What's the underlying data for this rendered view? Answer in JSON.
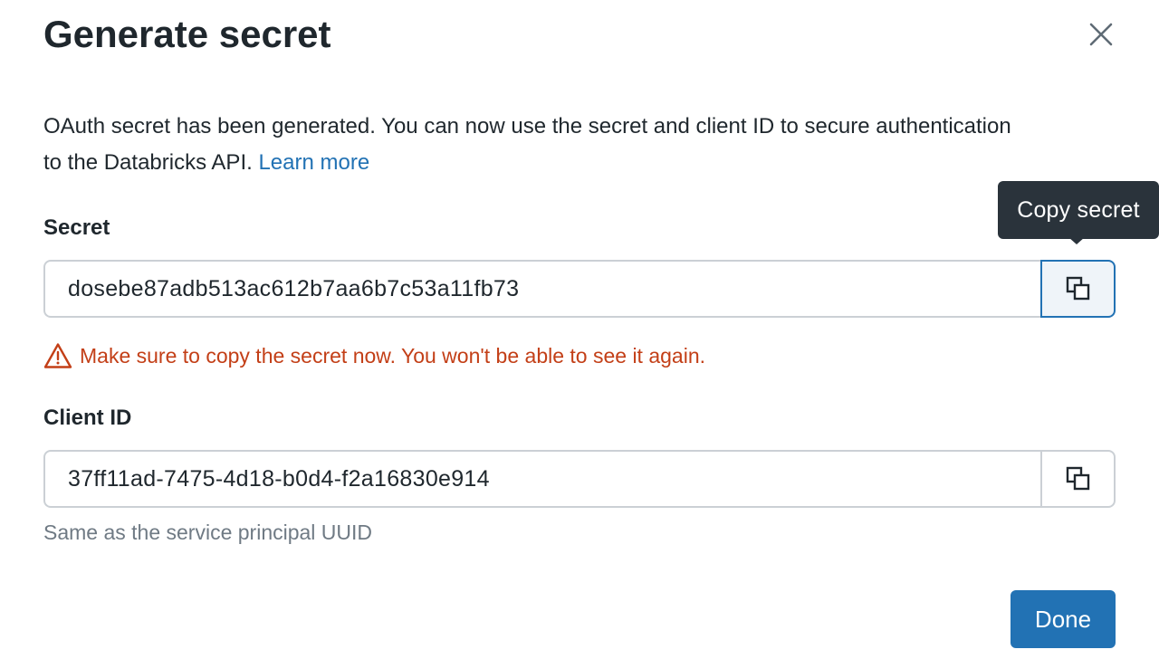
{
  "dialog": {
    "title": "Generate secret",
    "description_text": "OAuth secret has been generated. You can now use the secret and client ID to secure authentication to the Databricks API.",
    "learn_more_label": "Learn more",
    "close_icon": "close-icon"
  },
  "secret": {
    "label": "Secret",
    "value": "dosebe87adb513ac612b7aa6b7c53a11fb73",
    "copy_icon": "copy-icon",
    "tooltip": "Copy secret",
    "warning_icon": "warning-triangle-icon",
    "warning": "Make sure to copy the secret now. You won't be able to see it again."
  },
  "client": {
    "label": "Client ID",
    "value": "37ff11ad-7475-4d18-b0d4-f2a16830e914",
    "copy_icon": "copy-icon",
    "hint": "Same as the service principal UUID"
  },
  "footer": {
    "done_label": "Done"
  },
  "colors": {
    "primary": "#2272b4",
    "warning": "#c33f17",
    "tooltip_bg": "#2a333b",
    "text": "#1f272d",
    "secondary_text": "#6f7a84",
    "border": "#cbd0d5"
  }
}
